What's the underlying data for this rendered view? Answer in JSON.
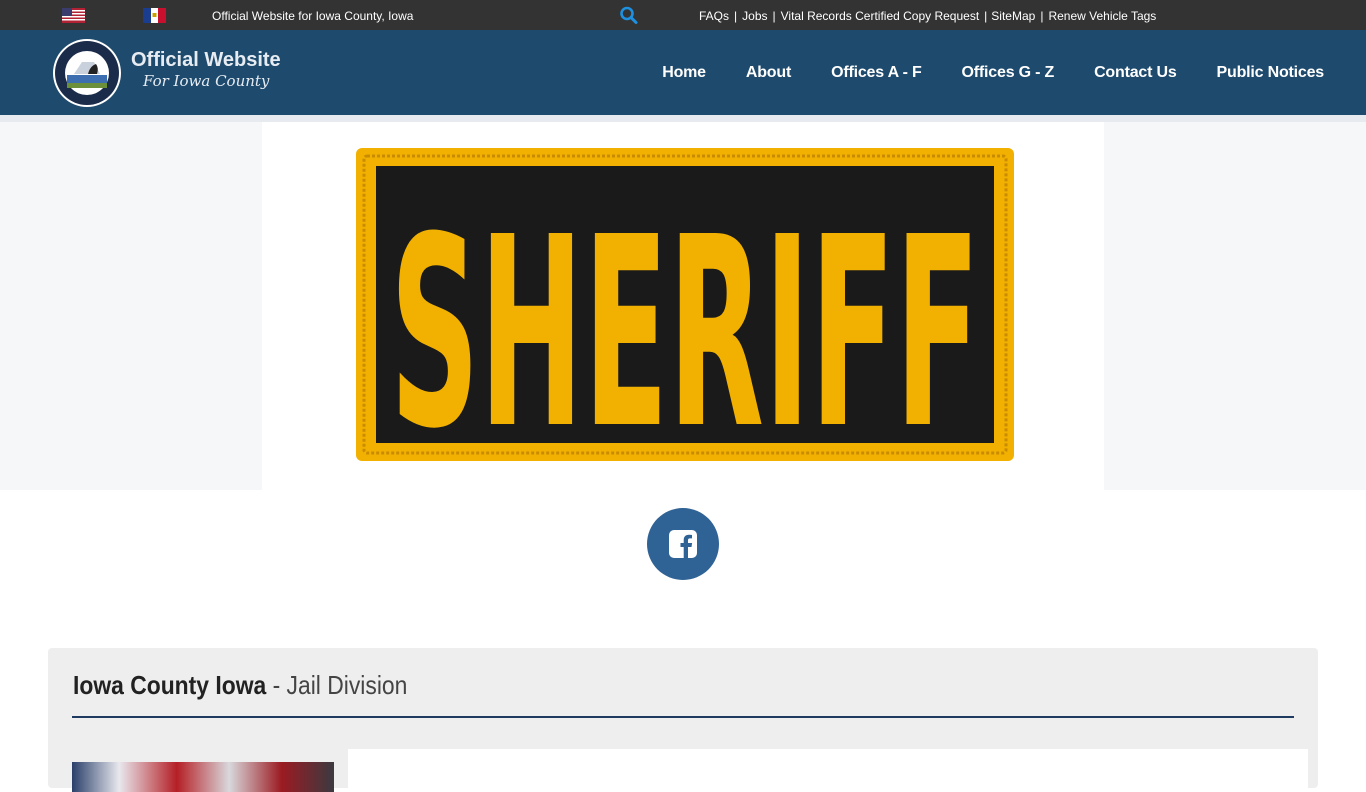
{
  "topbar": {
    "tagline": "Official Website for Iowa County, Iowa",
    "links": [
      "FAQs",
      "Jobs",
      "Vital Records Certified Copy Request",
      "SiteMap",
      "Renew Vehicle Tags"
    ],
    "separator": "|"
  },
  "header": {
    "brand_title": "Official Website",
    "brand_subtitle": "For Iowa County",
    "nav": [
      "Home",
      "About",
      "Offices A - F",
      "Offices G - Z",
      "Contact Us",
      "Public Notices"
    ]
  },
  "banner": {
    "patch_text": "SHERIFF"
  },
  "content": {
    "title_strong": "Iowa County Iowa",
    "title_rest": " - Jail Division"
  },
  "colors": {
    "topbar": "#333333",
    "header": "#1e4a6d",
    "search_icon": "#1e90e0",
    "patch_gold": "#f2b100",
    "patch_black": "#1a1a1a",
    "facebook": "#2f6295",
    "rule": "#1e3a5f"
  },
  "icons": {
    "search": "search-icon",
    "facebook": "facebook-icon",
    "flag_us": "us-flag-icon",
    "flag_iowa": "iowa-flag-icon"
  }
}
